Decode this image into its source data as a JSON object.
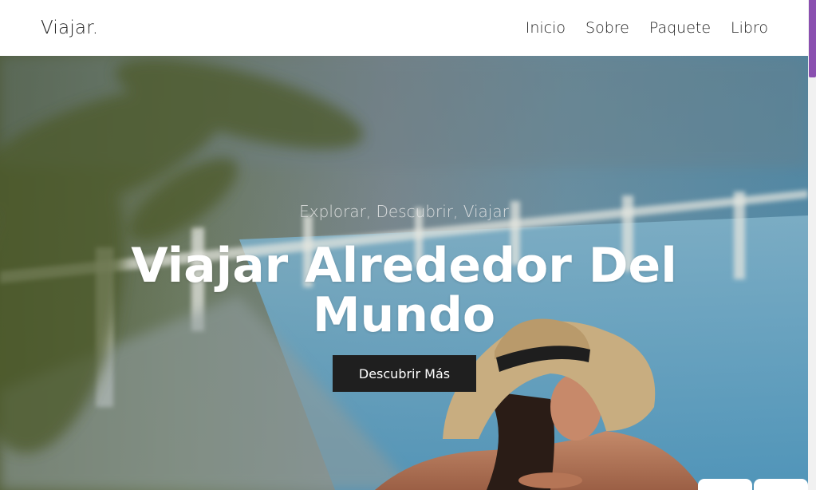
{
  "header": {
    "logo": "Viajar.",
    "nav": [
      "Inicio",
      "Sobre",
      "Paquete",
      "Libro"
    ]
  },
  "hero": {
    "tagline": "Explorar, Descubrir, Viajar",
    "title": "Viajar Alrededor Del Mundo",
    "cta_label": "Descubrir Más"
  },
  "colors": {
    "accent_scrollbar": "#8a4fb0",
    "button_bg": "#1f1f1f",
    "pool_blue": "#5f9fc0"
  }
}
